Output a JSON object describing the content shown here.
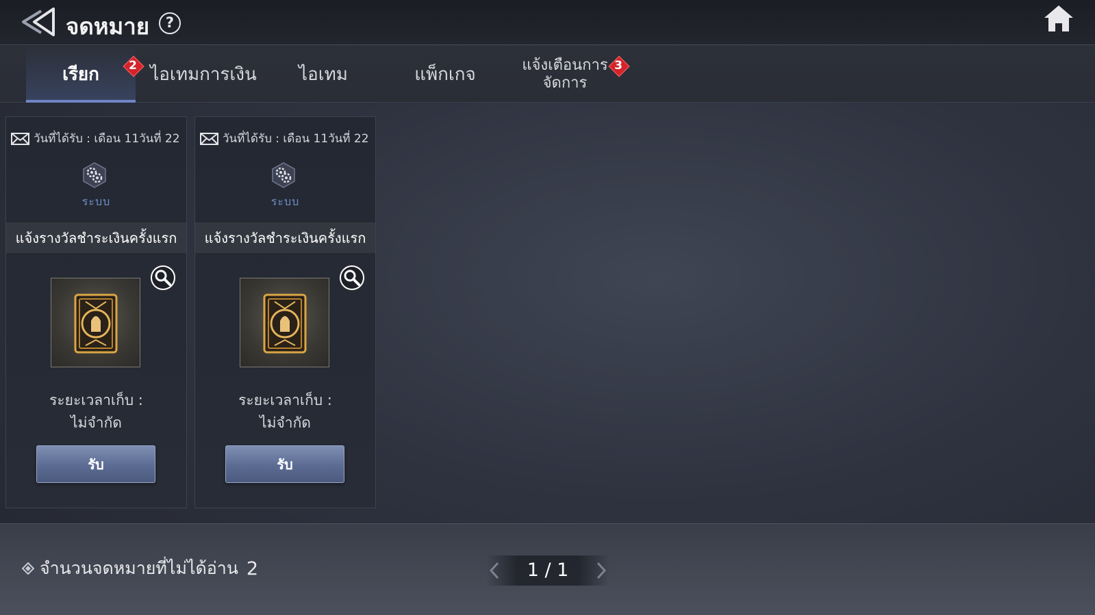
{
  "header": {
    "title": "จดหมาย",
    "help_icon": "?",
    "back_icon": "back-arrow-icon",
    "home_icon": "home-icon"
  },
  "tabs": [
    {
      "label": "เรียก",
      "active": true,
      "badge": "2"
    },
    {
      "label": "ไอเทมการเงิน",
      "active": false
    },
    {
      "label": "ไอเทม",
      "active": false
    },
    {
      "label": "แพ็กเกจ",
      "active": false
    },
    {
      "label_line1": "แจ้งเตือนการ",
      "label_line2": "จัดการ",
      "active": false,
      "badge": "3"
    }
  ],
  "mails": [
    {
      "date": "วันที่ได้รับ : เดือน 11วันที่ 22",
      "sender": "ระบบ",
      "subject": "แจ้งรางวัลชำระเงินครั้งแรก",
      "keep_line1": "ระยะเวลาเก็บ :",
      "keep_line2": "ไม่จำกัด",
      "button": "รับ"
    },
    {
      "date": "วันที่ได้รับ : เดือน 11วันที่ 22",
      "sender": "ระบบ",
      "subject": "แจ้งรางวัลชำระเงินครั้งแรก",
      "keep_line1": "ระยะเวลาเก็บ :",
      "keep_line2": "ไม่จำกัด",
      "button": "รับ"
    }
  ],
  "footer": {
    "unread_label": "จำนวนจดหมายที่ไม่ได้อ่าน",
    "unread_count": "2",
    "page": "1 / 1"
  },
  "colors": {
    "accent": "#6f86c6",
    "badge": "#d4232a",
    "sender": "#6e8fc8",
    "button": "#5b6b92"
  }
}
